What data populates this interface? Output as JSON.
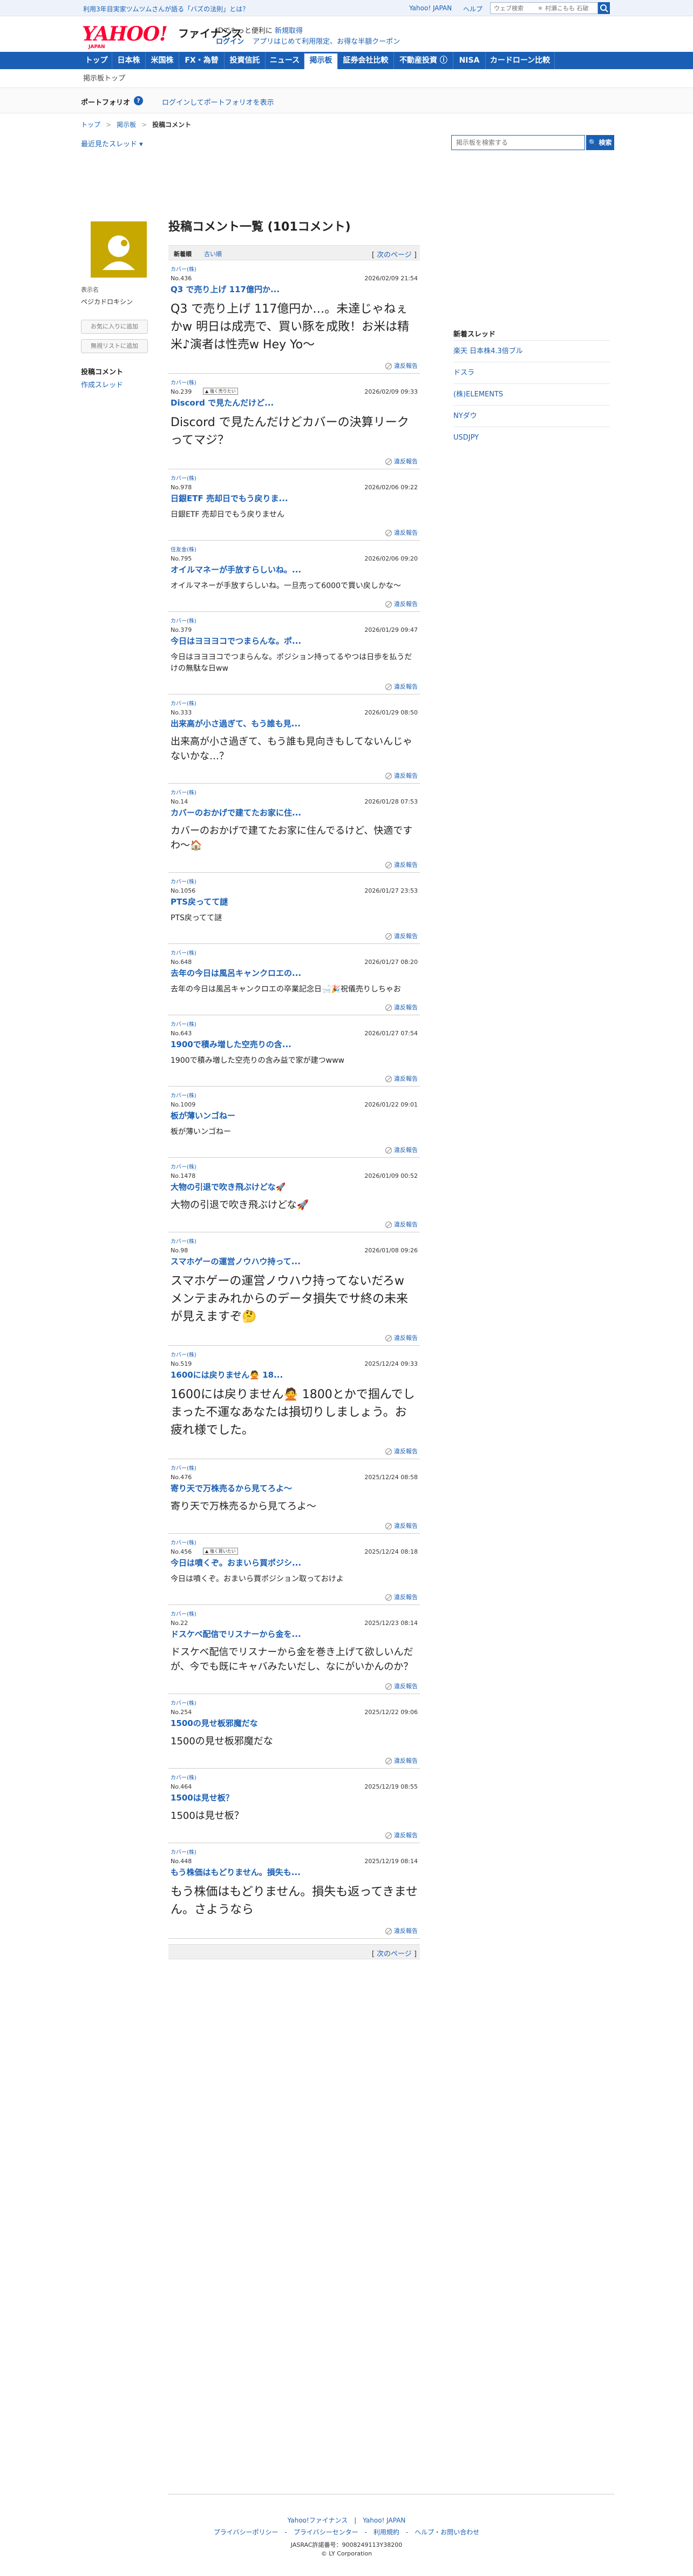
{
  "notice": {
    "message": "利用3年目実家ツムツムさんが語る「バズの法則」とは？",
    "yahoo_japan": "Yahoo! JAPAN",
    "help": "ヘルプ",
    "search_placeholder": "ウェブ検索　　 ＊ 村瀬こもも 石破"
  },
  "header": {
    "logo": "YAHOO!",
    "logo_sub": "JAPAN",
    "service": "ファイナンス",
    "promo_line1": "IDでもっと便利に",
    "promo_line1_link": "新規取得",
    "login": "ログイン",
    "promo_line2": "アプリはじめて利用限定、お得な半額クーポン"
  },
  "nav": [
    "トップ",
    "日本株",
    "米国株",
    "FX・為替",
    "投資信託",
    "ニュース",
    "掲示板",
    "証券会社比較",
    "不動産投資 ⓘ",
    "NISA",
    "カードローン比較"
  ],
  "board_top": "掲示板トップ",
  "portfolio": {
    "label": "ポートフォリオ",
    "q": "?",
    "login_link": "ログインしてポートフォリオを表示"
  },
  "breadcrumb": {
    "top": "トップ",
    "board": "掲示板",
    "current": "投稿コメント"
  },
  "recent_threads": "最近見たスレッド ▾",
  "board_search": {
    "placeholder": "掲示板を検索する",
    "button": "🔍 検索"
  },
  "profile": {
    "label": "表示名",
    "name": "ペジカドロキシン",
    "btn1": "お気に入りに追加",
    "btn2": "無視リストに追加",
    "link_bold": "投稿コメント",
    "link": "作成スレッド"
  },
  "main": {
    "title": "投稿コメント一覧 (101コメント)",
    "sort_new": "新着順",
    "sort_old": "古い順",
    "next_page": "次のページ",
    "report": "違反報告",
    "comments": [
      {
        "board": "カバー(株)",
        "no": "No.436",
        "date": "2026/02/09 21:54",
        "title": "Q3 で売り上げ 117億円か...",
        "body": "Q3 で売り上げ 117億円か…。未達じゃねぇかw 明日は成売で、買い豚を成敗！お米は精米♪演者は性売w Hey Yo〜",
        "size": "l",
        "badge": ""
      },
      {
        "board": "カバー(株)",
        "no": "No.239",
        "date": "2026/02/09 09:33",
        "title": "Discord で見たんだけど...",
        "body": "Discord で見たんだけどカバーの決算リークってマジ？",
        "size": "l",
        "badge": "▲ 強く売りたい"
      },
      {
        "board": "カバー(株)",
        "no": "No.978",
        "date": "2026/02/06 09:22",
        "title": "日銀ETF 売却日でもう戻りま...",
        "body": "日銀ETF 売却日でもう戻りません",
        "size": "s",
        "badge": ""
      },
      {
        "board": "住友金(株)",
        "no": "No.795",
        "date": "2026/02/06 09:20",
        "title": "オイルマネーが手放すらしいね。...",
        "body": "オイルマネーが手放すらしいね。一旦売って6000で買い戻しかな〜",
        "size": "s",
        "badge": ""
      },
      {
        "board": "カバー(株)",
        "no": "No.379",
        "date": "2026/01/29 09:47",
        "title": "今日はヨヨヨコでつまらんな。ポ...",
        "body": "今日はヨヨヨコでつまらんな。ポジション持ってるやつは日歩を払うだけの無駄な日ww",
        "size": "s",
        "badge": ""
      },
      {
        "board": "カバー(株)",
        "no": "No.333",
        "date": "2026/01/29 08:50",
        "title": "出来高が小さ過ぎて、もう誰も見...",
        "body": "出来高が小さ過ぎて、もう誰も見向きもしてないんじゃないかな…？",
        "size": "m",
        "badge": ""
      },
      {
        "board": "カバー(株)",
        "no": "No.14",
        "date": "2026/01/28 07:53",
        "title": "カバーのおかげで建てたお家に住...",
        "body": "カバーのおかげで建てたお家に住んでるけど、快適ですわ〜🏠",
        "size": "m",
        "badge": ""
      },
      {
        "board": "カバー(株)",
        "no": "No.1056",
        "date": "2026/01/27 23:53",
        "title": "PTS戻ってて謎",
        "body": "PTS戻ってて謎",
        "size": "s",
        "badge": ""
      },
      {
        "board": "カバー(株)",
        "no": "No.648",
        "date": "2026/01/27 08:20",
        "title": "去年の今日は風呂キャンクロエの...",
        "body": "去年の今日は風呂キャンクロエの卒業記念日🛁🎉祝儀売りしちゃお",
        "size": "s",
        "badge": ""
      },
      {
        "board": "カバー(株)",
        "no": "No.643",
        "date": "2026/01/27 07:54",
        "title": "1900で積み増した空売りの含...",
        "body": "1900で積み増した空売りの含み益で家が建つwww",
        "size": "s",
        "badge": ""
      },
      {
        "board": "カバー(株)",
        "no": "No.1009",
        "date": "2026/01/22 09:01",
        "title": "板が薄いンゴねー",
        "body": "板が薄いンゴねー",
        "size": "s",
        "badge": ""
      },
      {
        "board": "カバー(株)",
        "no": "No.1478",
        "date": "2026/01/09 00:52",
        "title": "大物の引退で吹き飛ぶけどな🚀",
        "body": "大物の引退で吹き飛ぶけどな🚀",
        "size": "m",
        "badge": ""
      },
      {
        "board": "カバー(株)",
        "no": "No.98",
        "date": "2026/01/08 09:26",
        "title": "スマホゲーの運営ノウハウ持って...",
        "body": "スマホゲーの運営ノウハウ持ってないだろw メンテまみれからのデータ損失でサ終の未来が見えますぞ🤔",
        "size": "l",
        "badge": ""
      },
      {
        "board": "カバー(株)",
        "no": "No.519",
        "date": "2025/12/24 09:33",
        "title": "1600には戻りません🙅 18...",
        "body": "1600には戻りません🙅 1800とかで掴んでしまった不運なあなたは損切りしましょう。お疲れ様でした。",
        "size": "l",
        "badge": ""
      },
      {
        "board": "カバー(株)",
        "no": "No.476",
        "date": "2025/12/24 08:58",
        "title": "寄り天で万株売るから見てろよ〜",
        "body": "寄り天で万株売るから見てろよ〜",
        "size": "m",
        "badge": ""
      },
      {
        "board": "カバー(株)",
        "no": "No.456",
        "date": "2025/12/24 08:18",
        "title": "今日は噴くぞ。おまいら買ポジシ...",
        "body": "今日は噴くぞ。おまいら買ポジション取っておけよ",
        "size": "s",
        "badge": "▲ 強く買いたい"
      },
      {
        "board": "カバー(株)",
        "no": "No.22",
        "date": "2025/12/23 08:14",
        "title": "ドスケベ配信でリスナーから金を...",
        "body": "ドスケベ配信でリスナーから金を巻き上げて欲しいんだが、今でも既にキャバみたいだし、なにがいかんのか？",
        "size": "m",
        "badge": ""
      },
      {
        "board": "カバー(株)",
        "no": "No.254",
        "date": "2025/12/22 09:06",
        "title": "1500の見せ板邪魔だな",
        "body": "1500の見せ板邪魔だな",
        "size": "m",
        "badge": ""
      },
      {
        "board": "カバー(株)",
        "no": "No.464",
        "date": "2025/12/19 08:55",
        "title": "1500は見せ板？",
        "body": "1500は見せ板？",
        "size": "m",
        "badge": ""
      },
      {
        "board": "カバー(株)",
        "no": "No.448",
        "date": "2025/12/19 08:14",
        "title": "もう株価はもどりません。損失も...",
        "body": "もう株価はもどりません。損失も返ってきません。さようなら",
        "size": "l",
        "badge": ""
      }
    ]
  },
  "new_threads": {
    "title": "新着スレッド",
    "items": [
      "楽天 日本株4.3倍ブル",
      "ドスラ",
      "(株)ELEMENTS",
      "NYダウ",
      "USDJPY"
    ]
  },
  "footer": {
    "line1": "Yahoo!ファイナンス　|　Yahoo! JAPAN",
    "line2": "プライバシーポリシー　-　プライバシーセンター　-　利用規約　-　ヘルプ・お問い合わせ",
    "line3": "JASRAC許諾番号：9008249113Y38200",
    "line4": "© LY Corporation"
  }
}
